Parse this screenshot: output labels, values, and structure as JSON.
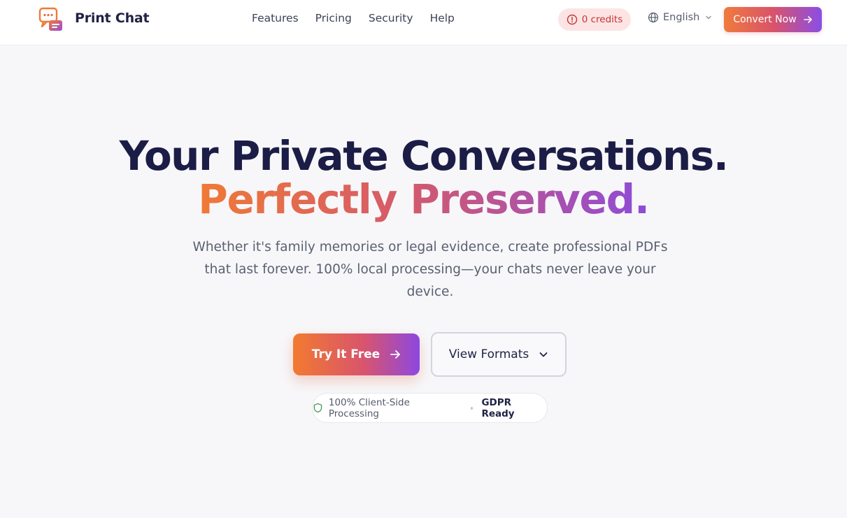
{
  "header": {
    "brand": "Print Chat",
    "nav": [
      "Features",
      "Pricing",
      "Security",
      "Help"
    ],
    "credits": "0 credits",
    "language": "English",
    "cta": "Convert Now"
  },
  "hero": {
    "title_line1": "Your Private Conversations.",
    "title_line2": "Perfectly Preserved.",
    "subtitle": "Whether it's family memories or legal evidence, create professional PDFs that last forever. 100% local processing—your chats never leave your device.",
    "primary_button": "Try It Free",
    "secondary_button": "View Formats",
    "badge_left": "100% Client-Side Processing",
    "badge_right": "GDPR Ready"
  },
  "icons": {
    "logo": "chat-bubbles-logo-icon",
    "credits": "alert-circle-icon",
    "language": "globe-icon",
    "arrow": "arrow-right-icon",
    "dropdown": "chevron-down-icon",
    "shield": "shield-icon"
  },
  "colors": {
    "accent_start": "#ef7a36",
    "accent_mid": "#d55a6a",
    "accent_end": "#8e4bd8",
    "heading": "#1c1d46",
    "credits_bg": "#fde4e4",
    "credits_text": "#c53434",
    "shield": "#3f9a58"
  }
}
